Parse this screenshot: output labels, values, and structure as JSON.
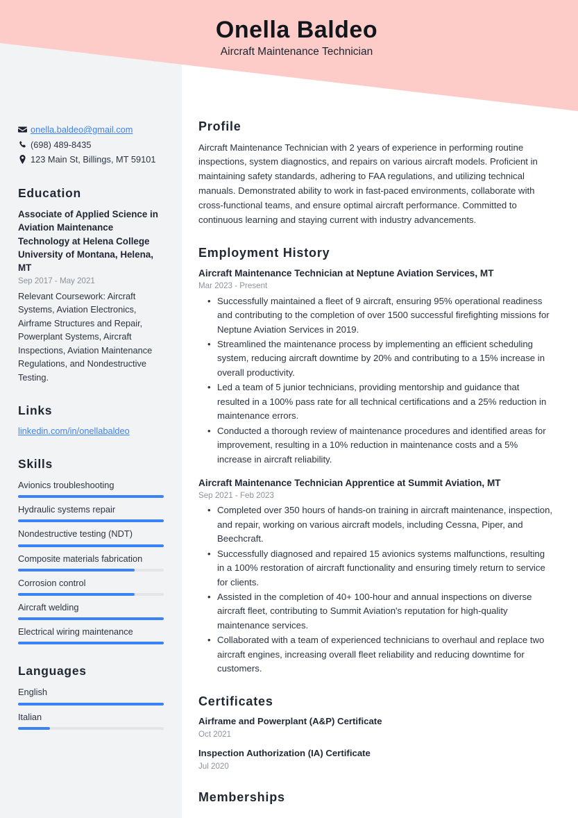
{
  "theme": {
    "header_pink": "#fdcbc8",
    "sidebar_gray": "#f2f3f5",
    "accent_blue": "#3b82f6",
    "heading_navy": "#1f2733",
    "muted_gray": "#8c929c"
  },
  "header": {
    "name": "Onella Baldeo",
    "job_title": "Aircraft Maintenance Technician"
  },
  "sidebar": {
    "contact": {
      "email": "onella.baldeo@gmail.com",
      "phone": "(698) 489-8435",
      "address": "123 Main St, Billings, MT 59101"
    },
    "education": {
      "heading": "Education",
      "items": [
        {
          "title": "Associate of Applied Science in Aviation Maintenance Technology at Helena College University of Montana, Helena, MT",
          "date": "Sep 2017 - May 2021",
          "description": "Relevant Coursework: Aircraft Systems, Aviation Electronics, Airframe Structures and Repair, Powerplant Systems, Aircraft Inspections, Aviation Maintenance Regulations, and Nondestructive Testing."
        }
      ]
    },
    "links": {
      "heading": "Links",
      "items": [
        {
          "label": "linkedin.com/in/onellabaldeo"
        }
      ]
    },
    "skills": {
      "heading": "Skills",
      "items": [
        {
          "label": "Avionics troubleshooting",
          "level": 100
        },
        {
          "label": "Hydraulic systems repair",
          "level": 100
        },
        {
          "label": "Nondestructive testing (NDT)",
          "level": 100
        },
        {
          "label": "Composite materials fabrication",
          "level": 80
        },
        {
          "label": "Corrosion control",
          "level": 80
        },
        {
          "label": "Aircraft welding",
          "level": 100
        },
        {
          "label": "Electrical wiring maintenance",
          "level": 100
        }
      ]
    },
    "languages": {
      "heading": "Languages",
      "items": [
        {
          "label": "English",
          "level": 100
        },
        {
          "label": "Italian",
          "level": 22
        }
      ]
    }
  },
  "main": {
    "profile": {
      "heading": "Profile",
      "text": "Aircraft Maintenance Technician with 2 years of experience in performing routine inspections, system diagnostics, and repairs on various aircraft models. Proficient in maintaining safety standards, adhering to FAA regulations, and utilizing technical manuals. Demonstrated ability to work in fast-paced environments, collaborate with cross-functional teams, and ensure optimal aircraft performance. Committed to continuous learning and staying current with industry advancements."
    },
    "employment": {
      "heading": "Employment History",
      "jobs": [
        {
          "title": "Aircraft Maintenance Technician at Neptune Aviation Services, MT",
          "date": "Mar 2023 - Present",
          "bullets": [
            "Successfully maintained a fleet of 9 aircraft, ensuring 95% operational readiness and contributing to the completion of over 1500 successful firefighting missions for Neptune Aviation Services in 2019.",
            "Streamlined the maintenance process by implementing an efficient scheduling system, reducing aircraft downtime by 20% and contributing to a 15% increase in overall productivity.",
            "Led a team of 5 junior technicians, providing mentorship and guidance that resulted in a 100% pass rate for all technical certifications and a 25% reduction in maintenance errors.",
            "Conducted a thorough review of maintenance procedures and identified areas for improvement, resulting in a 10% reduction in maintenance costs and a 5% increase in aircraft reliability."
          ]
        },
        {
          "title": "Aircraft Maintenance Technician Apprentice at Summit Aviation, MT",
          "date": "Sep 2021 - Feb 2023",
          "bullets": [
            "Completed over 350 hours of hands-on training in aircraft maintenance, inspection, and repair, working on various aircraft models, including Cessna, Piper, and Beechcraft.",
            "Successfully diagnosed and repaired 15 avionics systems malfunctions, resulting in a 100% restoration of aircraft functionality and ensuring timely return to service for clients.",
            "Assisted in the completion of 40+ 100-hour and annual inspections on diverse aircraft fleet, contributing to Summit Aviation's reputation for high-quality maintenance services.",
            "Collaborated with a team of experienced technicians to overhaul and replace two aircraft engines, increasing overall fleet reliability and reducing downtime for customers."
          ]
        }
      ]
    },
    "certificates": {
      "heading": "Certificates",
      "items": [
        {
          "title": "Airframe and Powerplant (A&P) Certificate",
          "date": "Oct 2021"
        },
        {
          "title": "Inspection Authorization (IA) Certificate",
          "date": "Jul 2020"
        }
      ]
    },
    "memberships": {
      "heading": "Memberships"
    }
  }
}
